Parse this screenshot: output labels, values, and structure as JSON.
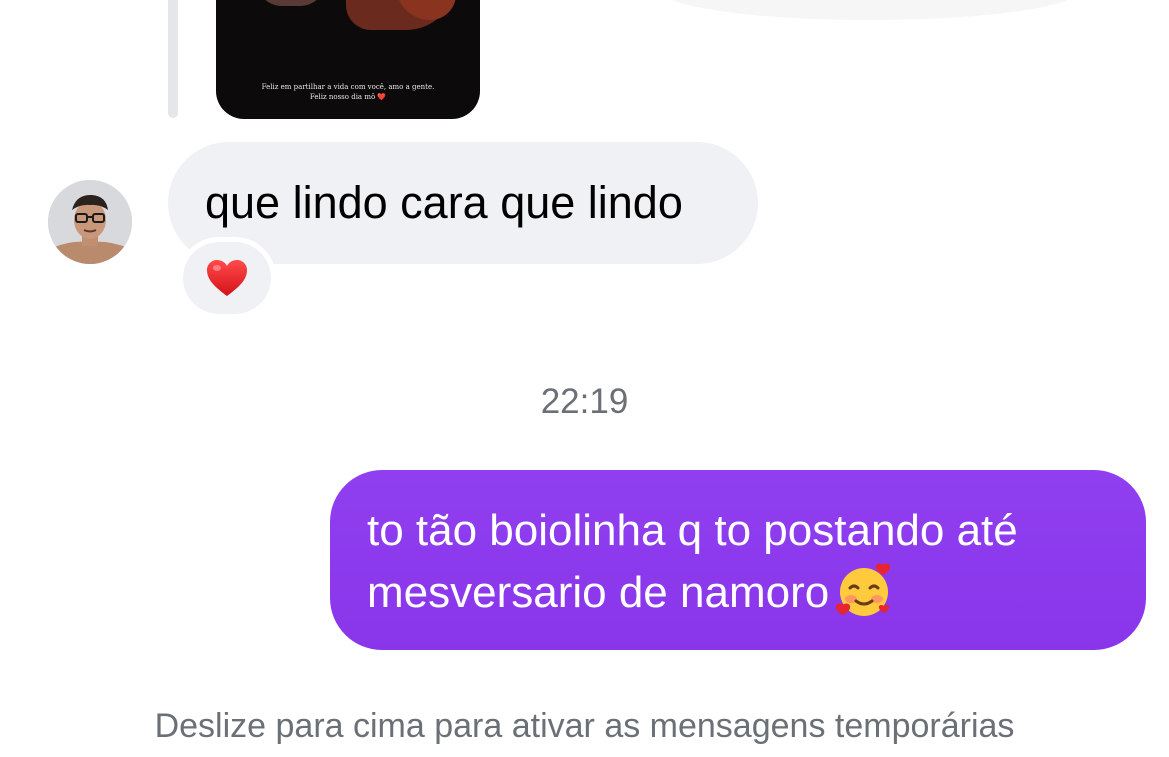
{
  "story_reply": {
    "caption_line1": "Feliz em partilhar a vida com você, amo a gente.",
    "caption_line2": "Feliz nosso dia mô",
    "caption_heart": "❤️"
  },
  "received_message": {
    "text": "que lindo cara que lindo",
    "reaction": "❤️"
  },
  "timestamp": "22:19",
  "sent_message": {
    "text": "to tão boiolinha q to postando até mesversario de namoro",
    "emoji_icon": "smiling-face-with-hearts-icon"
  },
  "footer": {
    "hint": "Deslize para cima para ativar as mensagens temporárias"
  },
  "colors": {
    "sent_bubble": "#8f3ff0",
    "received_bubble": "#eff1f4",
    "meta_text": "#6b6f76"
  }
}
